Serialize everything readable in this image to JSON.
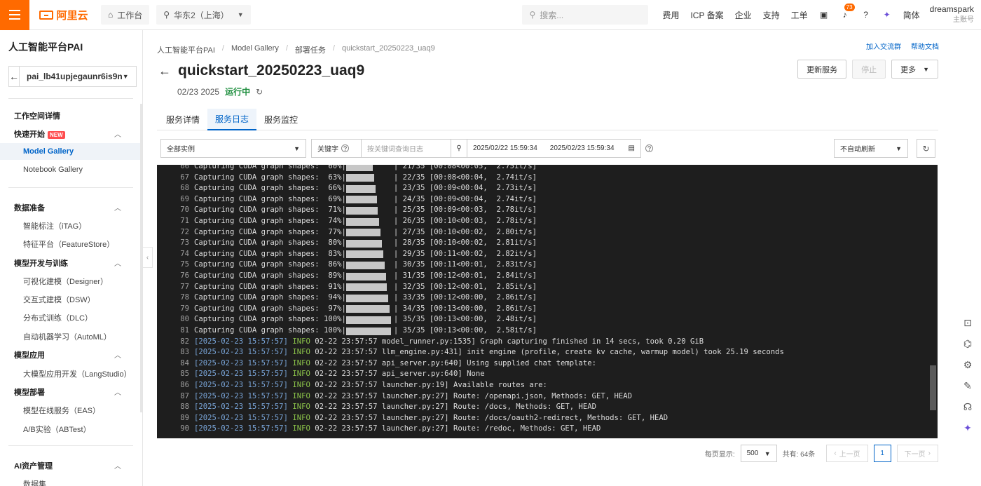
{
  "topbar": {
    "logo_text": "阿里云",
    "workbench": "工作台",
    "region": "华东2（上海）",
    "search_placeholder": "搜索...",
    "links": [
      "费用",
      "ICP 备案",
      "企业",
      "支持",
      "工单"
    ],
    "notif_count": "73",
    "lang": "简体",
    "user_name": "dreamspark",
    "user_sub": "主账号"
  },
  "sidebar": {
    "title": "人工智能平台PAI",
    "workspace": "pai_lb41upjegaunr6is9n",
    "workspace_detail": "工作空间详情",
    "quickstart": "快速开始",
    "new_badge": "NEW",
    "items_quick": [
      "Model Gallery",
      "Notebook Gallery"
    ],
    "data_prep": "数据准备",
    "items_data": [
      "智能标注（iTAG）",
      "特征平台（FeatureStore）"
    ],
    "model_dev": "模型开发与训练",
    "items_dev": [
      "可视化建模（Designer）",
      "交互式建模（DSW）",
      "分布式训练（DLC）",
      "自动机器学习（AutoML）"
    ],
    "model_app": "模型应用",
    "items_app": [
      "大模型应用开发（LangStudio）"
    ],
    "model_deploy": "模型部署",
    "items_deploy": [
      "模型在线服务（EAS）",
      "A/B实验（ABTest）"
    ],
    "ai_assets": "AI资产管理",
    "items_assets": [
      "数据集"
    ]
  },
  "breadcrumb": [
    "人工智能平台PAI",
    "Model Gallery",
    "部署任务",
    "quickstart_20250223_uaq9"
  ],
  "top_links": [
    "加入交流群",
    "帮助文档"
  ],
  "page": {
    "title": "quickstart_20250223_uaq9",
    "date": "02/23 2025",
    "status": "运行中"
  },
  "actions": {
    "update": "更新服务",
    "stop": "停止",
    "more": "更多"
  },
  "tabs": [
    "服务详情",
    "服务日志",
    "服务监控"
  ],
  "filter": {
    "instance": "全部实例",
    "keyword_label": "关键字",
    "keyword_placeholder": "按关键词查询日志",
    "start": "2025/02/22 15:59:34",
    "end": "2025/02/23 15:59:34",
    "refresh": "不自动刷新"
  },
  "log_capture": [
    {
      "n": "66",
      "pct": "60%",
      "frac": 0.6,
      "tail": "| 21/35 [00:08<00:05,  2.75it/s]"
    },
    {
      "n": "67",
      "pct": "63%",
      "frac": 0.63,
      "tail": "| 22/35 [00:08<00:04,  2.74it/s]"
    },
    {
      "n": "68",
      "pct": "66%",
      "frac": 0.66,
      "tail": "| 23/35 [00:09<00:04,  2.73it/s]"
    },
    {
      "n": "69",
      "pct": "69%",
      "frac": 0.69,
      "tail": "| 24/35 [00:09<00:04,  2.74it/s]"
    },
    {
      "n": "70",
      "pct": "71%",
      "frac": 0.71,
      "tail": "| 25/35 [00:09<00:03,  2.78it/s]"
    },
    {
      "n": "71",
      "pct": "74%",
      "frac": 0.74,
      "tail": "| 26/35 [00:10<00:03,  2.78it/s]"
    },
    {
      "n": "72",
      "pct": "77%",
      "frac": 0.77,
      "tail": "| 27/35 [00:10<00:02,  2.80it/s]"
    },
    {
      "n": "73",
      "pct": "80%",
      "frac": 0.8,
      "tail": "| 28/35 [00:10<00:02,  2.81it/s]"
    },
    {
      "n": "74",
      "pct": "83%",
      "frac": 0.83,
      "tail": "| 29/35 [00:11<00:02,  2.82it/s]"
    },
    {
      "n": "75",
      "pct": "86%",
      "frac": 0.86,
      "tail": "| 30/35 [00:11<00:01,  2.83it/s]"
    },
    {
      "n": "76",
      "pct": "89%",
      "frac": 0.89,
      "tail": "| 31/35 [00:12<00:01,  2.84it/s]"
    },
    {
      "n": "77",
      "pct": "91%",
      "frac": 0.91,
      "tail": "| 32/35 [00:12<00:01,  2.85it/s]"
    },
    {
      "n": "78",
      "pct": "94%",
      "frac": 0.94,
      "tail": "| 33/35 [00:12<00:00,  2.86it/s]"
    },
    {
      "n": "79",
      "pct": "97%",
      "frac": 0.97,
      "tail": "| 34/35 [00:13<00:00,  2.86it/s]"
    },
    {
      "n": "80",
      "pct": "100%",
      "frac": 1.0,
      "tail": "| 35/35 [00:13<00:00,  2.48it/s]"
    },
    {
      "n": "81",
      "pct": "100%",
      "frac": 1.0,
      "tail": "| 35/35 [00:13<00:00,  2.58it/s]"
    }
  ],
  "log_info": [
    {
      "n": "82",
      "ts": "[2025-02-23 15:57:57]",
      "lvl": "INFO",
      "msg": "02-22 23:57:57 model_runner.py:1535] Graph capturing finished in 14 secs, took 0.20 GiB"
    },
    {
      "n": "83",
      "ts": "[2025-02-23 15:57:57]",
      "lvl": "INFO",
      "msg": "02-22 23:57:57 llm_engine.py:431] init engine (profile, create kv cache, warmup model) took 25.19 seconds"
    },
    {
      "n": "84",
      "ts": "[2025-02-23 15:57:57]",
      "lvl": "INFO",
      "msg": "02-22 23:57:57 api_server.py:640] Using supplied chat template:"
    },
    {
      "n": "85",
      "ts": "[2025-02-23 15:57:57]",
      "lvl": "INFO",
      "msg": "02-22 23:57:57 api_server.py:640] None"
    },
    {
      "n": "86",
      "ts": "[2025-02-23 15:57:57]",
      "lvl": "INFO",
      "msg": "02-22 23:57:57 launcher.py:19] Available routes are:"
    },
    {
      "n": "87",
      "ts": "[2025-02-23 15:57:57]",
      "lvl": "INFO",
      "msg": "02-22 23:57:57 launcher.py:27] Route: /openapi.json, Methods: GET, HEAD"
    },
    {
      "n": "88",
      "ts": "[2025-02-23 15:57:57]",
      "lvl": "INFO",
      "msg": "02-22 23:57:57 launcher.py:27] Route: /docs, Methods: GET, HEAD"
    },
    {
      "n": "89",
      "ts": "[2025-02-23 15:57:57]",
      "lvl": "INFO",
      "msg": "02-22 23:57:57 launcher.py:27] Route: /docs/oauth2-redirect, Methods: GET, HEAD"
    },
    {
      "n": "90",
      "ts": "[2025-02-23 15:57:57]",
      "lvl": "INFO",
      "msg": "02-22 23:57:57 launcher.py:27] Route: /redoc, Methods: GET, HEAD"
    }
  ],
  "pager": {
    "per_page_label": "每页显示:",
    "per_page": "500",
    "total": "共有: 64条",
    "prev": "上一页",
    "page": "1",
    "next": "下一页"
  }
}
